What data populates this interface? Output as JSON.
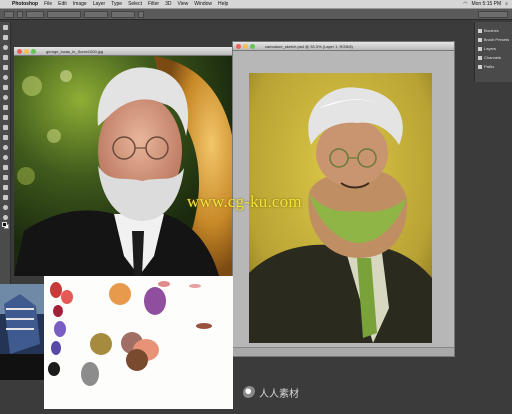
{
  "menubar": {
    "items": [
      "Photoshop",
      "File",
      "Edit",
      "Image",
      "Layer",
      "Type",
      "Select",
      "Filter",
      "3D",
      "View",
      "Window",
      "Help"
    ],
    "clock": "Mon 5:15 PM"
  },
  "right_panel": {
    "items": [
      "Brushes",
      "Brush Presets",
      "Layers",
      "Channels",
      "Paths"
    ]
  },
  "documents": {
    "photo_title": "george_lucas_in_Sumv1000.jpg",
    "painting_title": "caricature_sketch.psd @ 33.3% (Layer 1, RGB/8)"
  },
  "watermark": {
    "text": "www.cg-ku.com",
    "corner_text": "人人素材"
  },
  "colors": {
    "workspace_bg": "#3b3b3b",
    "painting_bg": "#c8b43a",
    "watermark": "#f2e23a"
  }
}
